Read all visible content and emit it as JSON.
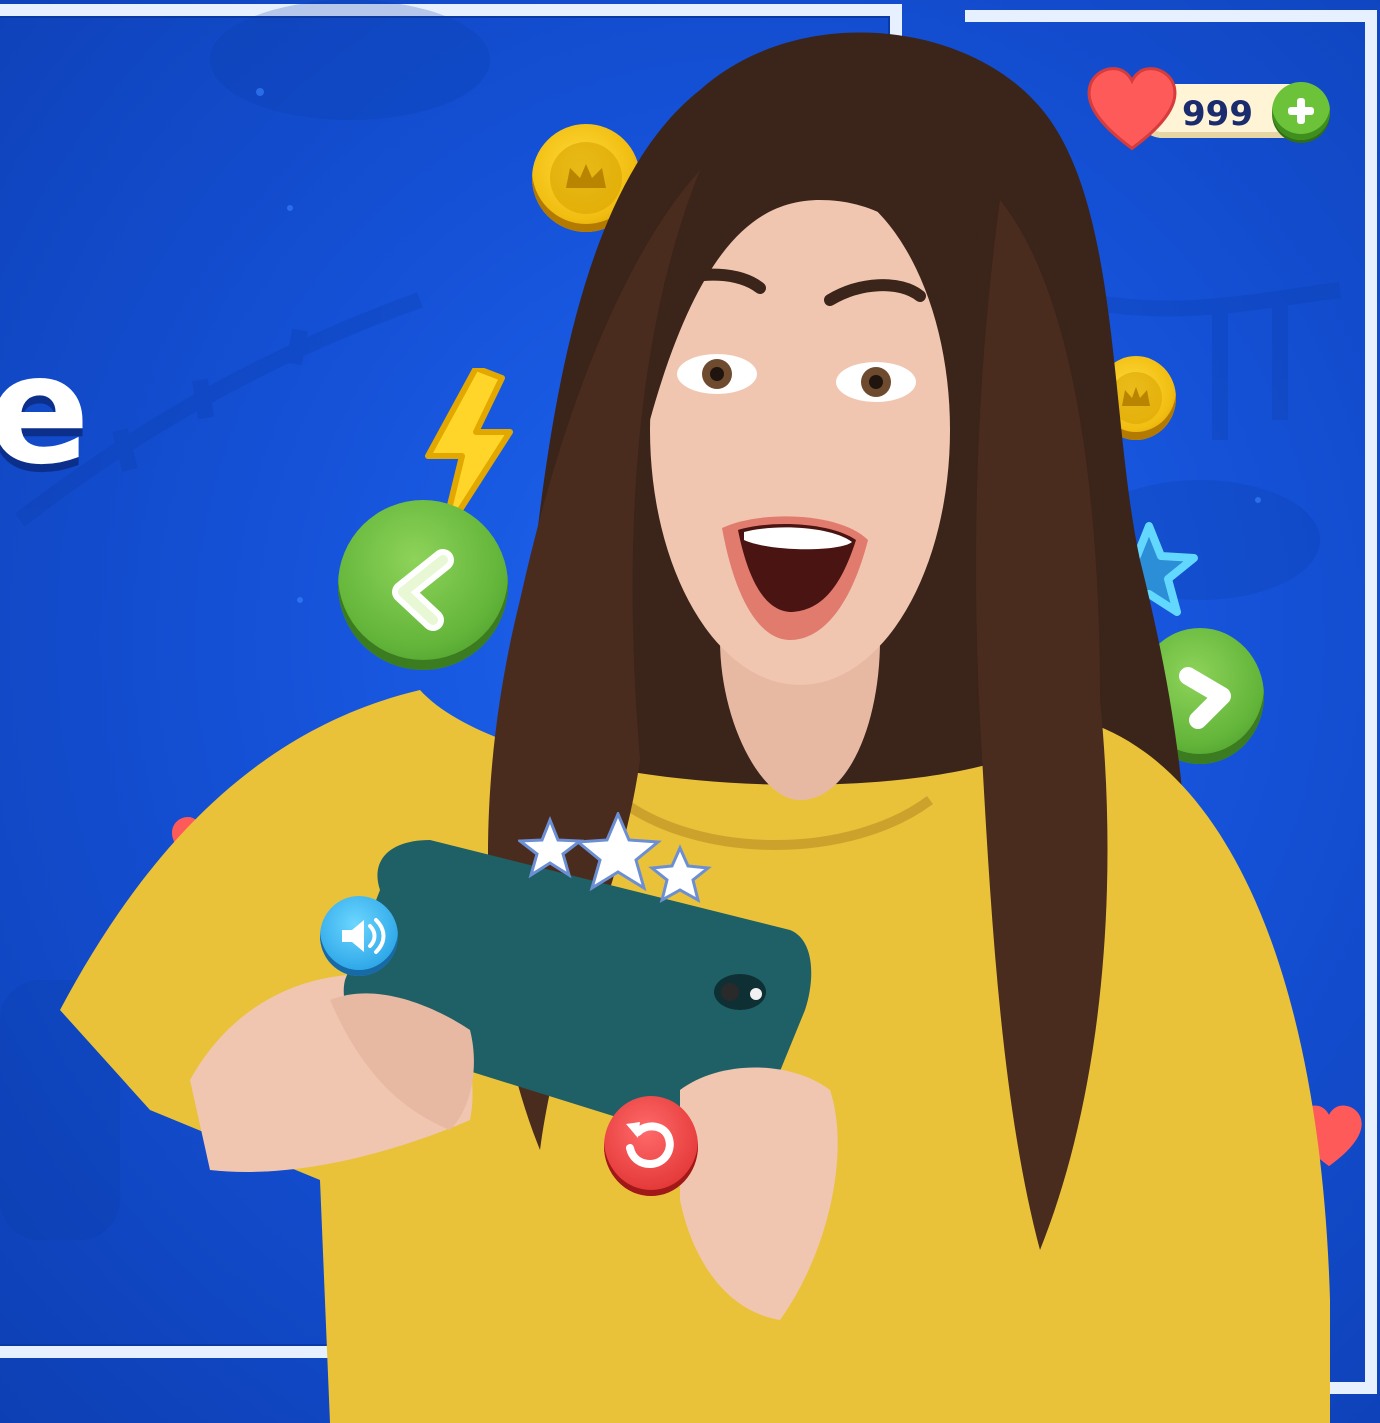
{
  "hero": {
    "heading_fragment": "e"
  },
  "hud": {
    "lives_count": "999",
    "heart_icon": "heart-icon",
    "add_icon": "plus-icon"
  },
  "icons": {
    "coin": "crown-coin-icon",
    "bolt": "lightning-bolt-icon",
    "arrow_left": "chevron-left-icon",
    "arrow_right": "chevron-right-icon",
    "star": "star-icon",
    "sound": "speaker-icon",
    "restart": "restart-icon"
  },
  "colors": {
    "background": "#1552d8",
    "frame": "#e6f0ff",
    "green_button": "#63b53a",
    "coin": "#f1bd11",
    "heart": "#ff5a5a",
    "shirt": "#e9c23a",
    "phone": "#1f5f66"
  }
}
